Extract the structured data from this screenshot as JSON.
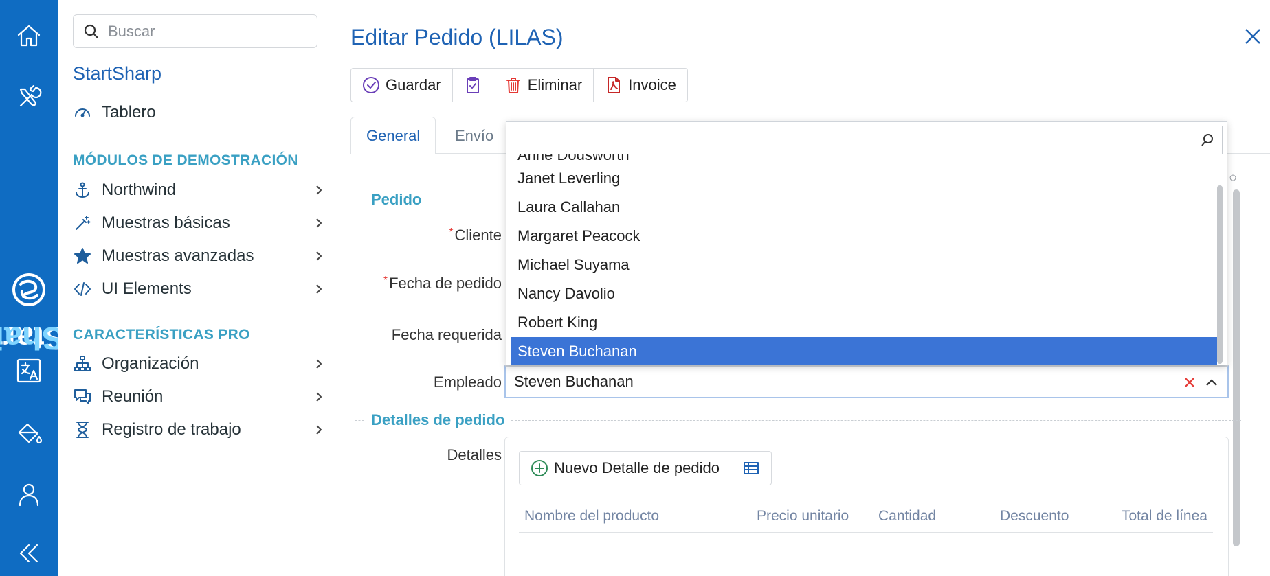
{
  "rail": {
    "brand_part1": "Start",
    "brand_part2": "Shai",
    "icons": [
      "home-icon",
      "tools-icon",
      "translate-icon",
      "paint-bucket-icon",
      "user-icon",
      "collapse-icon"
    ],
    "background": "#0f6cc2"
  },
  "nav": {
    "search_placeholder": "Buscar",
    "app_name": "StartSharp",
    "dashboard": "Tablero",
    "section_demo": "MÓDULOS DE DEMOSTRACIÓN",
    "demo_items": [
      {
        "label": "Northwind",
        "icon": "anchor-icon"
      },
      {
        "label": "Muestras básicas",
        "icon": "magic-wand-icon"
      },
      {
        "label": "Muestras avanzadas",
        "icon": "star-icon"
      },
      {
        "label": "UI Elements",
        "icon": "code-icon"
      }
    ],
    "section_pro": "CARACTERÍSTICAS PRO",
    "pro_items": [
      {
        "label": "Organización",
        "icon": "org-chart-icon"
      },
      {
        "label": "Reunión",
        "icon": "chat-icon"
      },
      {
        "label": "Registro de trabajo",
        "icon": "hourglass-icon"
      }
    ]
  },
  "dialog": {
    "title": "Editar Pedido (LILAS)",
    "toolbar": {
      "save": "Guardar",
      "delete": "Eliminar",
      "invoice": "Invoice"
    },
    "tabs": {
      "general": "General",
      "shipping": "Envío"
    },
    "sections": {
      "order": "Pedido",
      "details": "Detalles de pedido"
    },
    "labels": {
      "customer": "Cliente",
      "order_date": "Fecha de pedido",
      "required_date": "Fecha requerida",
      "employee": "Empleado",
      "details": "Detalles"
    },
    "employee_value": "Steven Buchanan",
    "dropdown": {
      "search_value": "",
      "partial_item": "Anne Dodsworth",
      "items": [
        "Janet Leverling",
        "Laura Callahan",
        "Margaret Peacock",
        "Michael Suyama",
        "Nancy Davolio",
        "Robert King",
        "Steven Buchanan"
      ],
      "selected": "Steven Buchanan"
    },
    "details_toolbar": {
      "new_detail": "Nuevo Detalle de pedido"
    },
    "grid_columns": [
      "Nombre del producto",
      "Precio unitario",
      "Cantidad",
      "Descuento",
      "Total de línea"
    ],
    "colors": {
      "accent": "#1f63b4",
      "section": "#3aa0c3",
      "selected": "#3b74d6",
      "required": "#e53935"
    }
  }
}
